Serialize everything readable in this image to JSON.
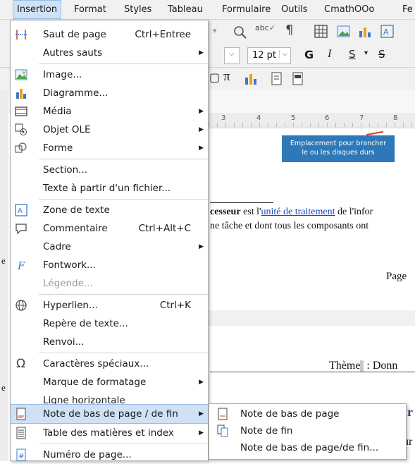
{
  "menubar": {
    "items": [
      {
        "label": "Insertion",
        "active": true
      },
      {
        "label": "Format"
      },
      {
        "label": "Styles"
      },
      {
        "label": "Tableau"
      },
      {
        "label": "Formulaire"
      },
      {
        "label": "Outils"
      },
      {
        "label": "CmathOOo"
      },
      {
        "label": "Fe"
      }
    ]
  },
  "toolbar": {
    "font_size": "12 pt",
    "bold_label": "G",
    "italic_label": "I",
    "underline_label": "S",
    "strike_label": "S",
    "ruler_numbers": [
      "3",
      "4",
      "5",
      "6",
      "7",
      "8"
    ]
  },
  "tooltip": {
    "line1": "Emplacement pour brancher",
    "line2": "le ou les disques durs"
  },
  "document": {
    "line1_bold": "cesseur",
    "line1_mid": " est l'",
    "line1_link": "unité de traitement",
    "line1_end": " de l'infor",
    "line2": "ne tâche et dont tous les composants ont",
    "line3": ".",
    "page_label": "Page",
    "theme_label": "Thème",
    "theme_value": " : Donn",
    "side_chars": [
      "e",
      "e"
    ],
    "right_chars": [
      "r",
      "ur"
    ]
  },
  "menu": {
    "items": [
      {
        "label": "Saut de page",
        "shortcut": "Ctrl+Entree",
        "icon": "page-break-icon"
      },
      {
        "label": "Autres sauts",
        "submenu": true
      },
      {
        "label": "Image...",
        "icon": "image-icon"
      },
      {
        "label": "Diagramme...",
        "icon": "chart-icon"
      },
      {
        "label": "Média",
        "submenu": true,
        "icon": "media-icon"
      },
      {
        "label": "Objet OLE",
        "submenu": true,
        "icon": "ole-object-icon"
      },
      {
        "label": "Forme",
        "submenu": true,
        "icon": "shape-icon"
      },
      {
        "label": "Section..."
      },
      {
        "label": "Texte à partir d'un fichier..."
      },
      {
        "label": "Zone de texte",
        "icon": "text-box-icon"
      },
      {
        "label": "Commentaire",
        "shortcut": "Ctrl+Alt+C",
        "icon": "comment-icon"
      },
      {
        "label": "Cadre",
        "submenu": true
      },
      {
        "label": "Fontwork...",
        "icon": "fontwork-icon"
      },
      {
        "label": "Légende...",
        "disabled": true
      },
      {
        "label": "Hyperlien...",
        "shortcut": "Ctrl+K",
        "icon": "hyperlink-icon"
      },
      {
        "label": "Repère de texte..."
      },
      {
        "label": "Renvoi..."
      },
      {
        "label": "Caractères spéciaux...",
        "icon": "omega-icon"
      },
      {
        "label": "Marque de formatage",
        "submenu": true
      },
      {
        "label": "Ligne horizontale"
      },
      {
        "label": "Note de bas de page / de fin",
        "submenu": true,
        "highlighted": true,
        "icon": "footnote-icon"
      },
      {
        "label": "Table des matières et index",
        "submenu": true,
        "icon": "toc-icon"
      },
      {
        "label": "Numéro de page...",
        "icon": "page-number-icon"
      }
    ]
  },
  "submenu": {
    "items": [
      {
        "label": "Note de bas de page",
        "icon": "footnote-icon"
      },
      {
        "label": "Note de fin",
        "icon": "endnote-icon"
      },
      {
        "label": "Note de bas de page/de fin..."
      }
    ]
  },
  "colors": {
    "highlight": "#cfe1f4",
    "highlight_border": "#99bde6",
    "tooltip": "#2d78b8",
    "link": "#1a46b8"
  }
}
